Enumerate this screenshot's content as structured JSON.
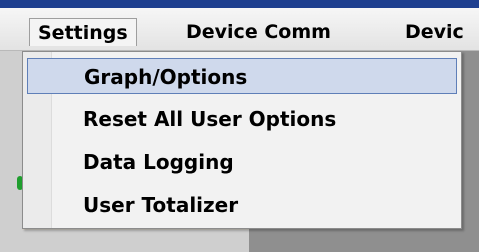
{
  "menubar": {
    "items": [
      {
        "label": "Settings"
      },
      {
        "label": "Device Comm"
      },
      {
        "label": "Devic"
      }
    ]
  },
  "dropdown": {
    "items": [
      {
        "label": "Graph/Options"
      },
      {
        "label": "Reset All User Options"
      },
      {
        "label": "Data Logging"
      },
      {
        "label": "User Totalizer"
      }
    ]
  },
  "colors": {
    "title_strip": "#1e3f8f",
    "highlight": "#cfd9ec",
    "highlight_border": "#5f7fb8",
    "status_indicator": "#1f9e2e"
  }
}
